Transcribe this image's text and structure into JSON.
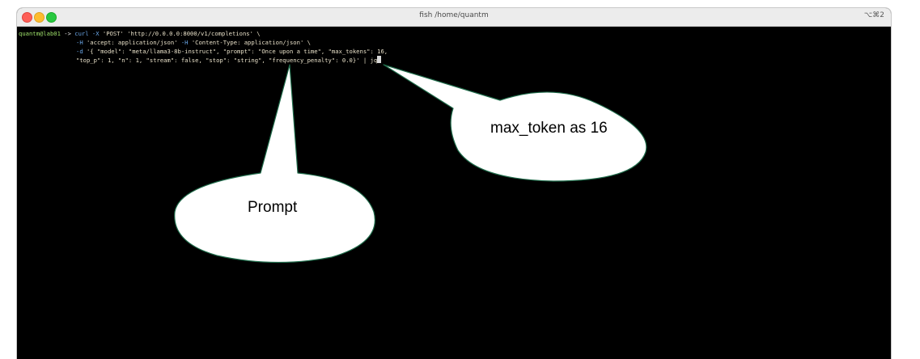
{
  "window": {
    "title": "fish /home/quantm",
    "shortcut": "⌥⌘2"
  },
  "terminal": {
    "prompt_user": "quantm@lab01",
    "prompt_arrow": "->",
    "line1_cmd": "curl",
    "line1_flag": "-X",
    "line1_rest": "'POST' 'http://0.0.0.0:8000/v1/completions' \\",
    "line2_flag1": "-H",
    "line2_str1": "'accept: application/json'",
    "line2_flag2": "-H",
    "line2_str2": "'Content-Type: application/json' \\",
    "line3_flag": "-d",
    "line3_rest": "'{ \"model\": \"meta/llama3-8b-instruct\", \"prompt\": \"Once upon a time\", \"max_tokens\": 16,",
    "line4": "\"top_p\": 1, \"n\": 1, \"stream\": false, \"stop\": \"string\", \"frequency_penalty\": 0.0}' | jq"
  },
  "callouts": {
    "max_token": "max_token as 16",
    "prompt": "Prompt"
  },
  "colors": {
    "callout_border": "#1f6b4a",
    "terminal_bg": "#000000"
  }
}
